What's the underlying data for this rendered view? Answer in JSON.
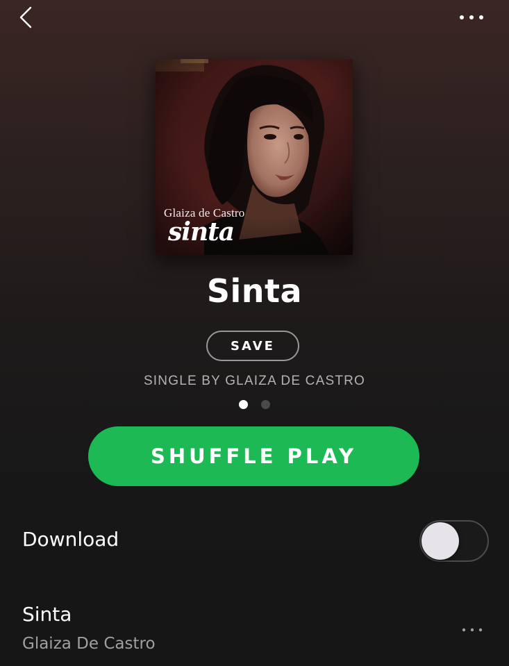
{
  "header": {
    "back_icon": "chevron-left-icon",
    "more_icon": "more-horizontal-icon"
  },
  "album": {
    "cover_artist": "Glaiza de Castro",
    "cover_title": "sinta",
    "title": "Sinta",
    "save_label": "SAVE",
    "subtitle": "SINGLE BY GLAIZA DE CASTRO"
  },
  "pager": {
    "current_page": 1,
    "total_pages": 2
  },
  "actions": {
    "shuffle_label": "SHUFFLE PLAY",
    "shuffle_color": "#1db954"
  },
  "download": {
    "label": "Download",
    "enabled": false
  },
  "tracks": [
    {
      "title": "Sinta",
      "artist": "Glaiza De Castro"
    }
  ]
}
